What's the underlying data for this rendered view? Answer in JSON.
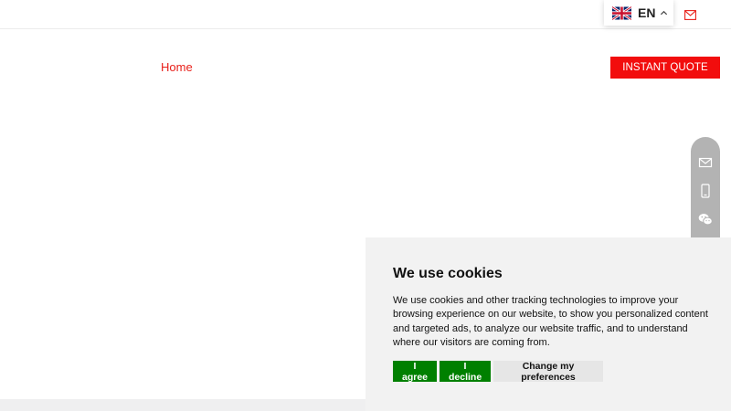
{
  "header": {
    "language": {
      "code": "EN",
      "flag": "uk-flag-icon",
      "caret": "chevron-up-icon"
    },
    "mail_icon": "envelope-icon",
    "accent_color": "#e8201a"
  },
  "nav": {
    "home_label": "Home",
    "quote_label": "INSTANT QUOTE"
  },
  "side_contact": {
    "items": [
      "envelope-icon",
      "mobile-phone-icon",
      "wechat-icon"
    ]
  },
  "cookie_banner": {
    "title": "We use cookies",
    "text": "We use cookies and other tracking technologies to improve your browsing experience on our website, to show you personalized content and targeted ads, to analyze our website traffic, and to understand where our visitors are coming from.",
    "agree_label": "I agree",
    "decline_label": "I decline",
    "preferences_label": "Change my preferences",
    "colors": {
      "agree": "#008000",
      "decline": "#008000",
      "preferences": "#e6e6e6"
    }
  }
}
